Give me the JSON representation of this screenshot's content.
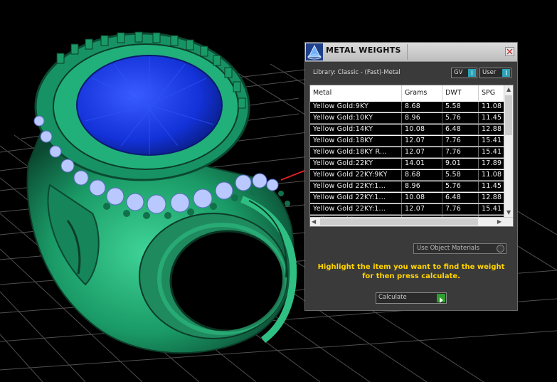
{
  "panel": {
    "title": "METAL WEIGHTS",
    "library_label": "Library: Classic - (Fast)-Metal",
    "toggle_gv": "GV",
    "toggle_user": "User",
    "columns": [
      "Metal",
      "Grams",
      "DWT",
      "SPG"
    ],
    "rows": [
      [
        "Yellow Gold:9KY",
        "8.68",
        "5.58",
        "11.08"
      ],
      [
        "Yellow Gold:10KY",
        "8.96",
        "5.76",
        "11.45"
      ],
      [
        "Yellow Gold:14KY",
        "10.08",
        "6.48",
        "12.88"
      ],
      [
        "Yellow Gold:18KY",
        "12.07",
        "7.76",
        "15.41"
      ],
      [
        "Yellow Gold:18KY R...",
        "12.07",
        "7.76",
        "15.41"
      ],
      [
        "Yellow Gold:22KY",
        "14.01",
        "9.01",
        "17.89"
      ],
      [
        "Yellow Gold 22KY:9KY",
        "8.68",
        "5.58",
        "11.08"
      ],
      [
        "Yellow Gold 22KY:1...",
        "8.96",
        "5.76",
        "11.45"
      ],
      [
        "Yellow Gold 22KY:1...",
        "10.08",
        "6.48",
        "12.88"
      ],
      [
        "Yellow Gold 22KY:1...",
        "12.07",
        "7.76",
        "15.41"
      ],
      [
        "Yellow Gold 22KY:1...",
        "12.07",
        "7.76",
        "15.41"
      ]
    ],
    "use_object_materials": "Use Object Materials",
    "instructions_line1": "Highlight the item you want to find the weight",
    "instructions_line2": "for then press calculate.",
    "calculate_label": "Calculate"
  },
  "colors": {
    "ring_green": "#1f9a6a",
    "gem_blue": "#1a3fe0",
    "instruction_yellow": "#ffd400",
    "toggle_teal": "#2aa3b8",
    "calc_green": "#2e9e2e"
  },
  "icons": [
    "app-logo-icon",
    "close-icon",
    "toggle-switch-icon",
    "scroll-up-icon",
    "scroll-down-icon",
    "scroll-left-icon",
    "scroll-right-icon",
    "play-icon",
    "radio-knob-icon"
  ]
}
